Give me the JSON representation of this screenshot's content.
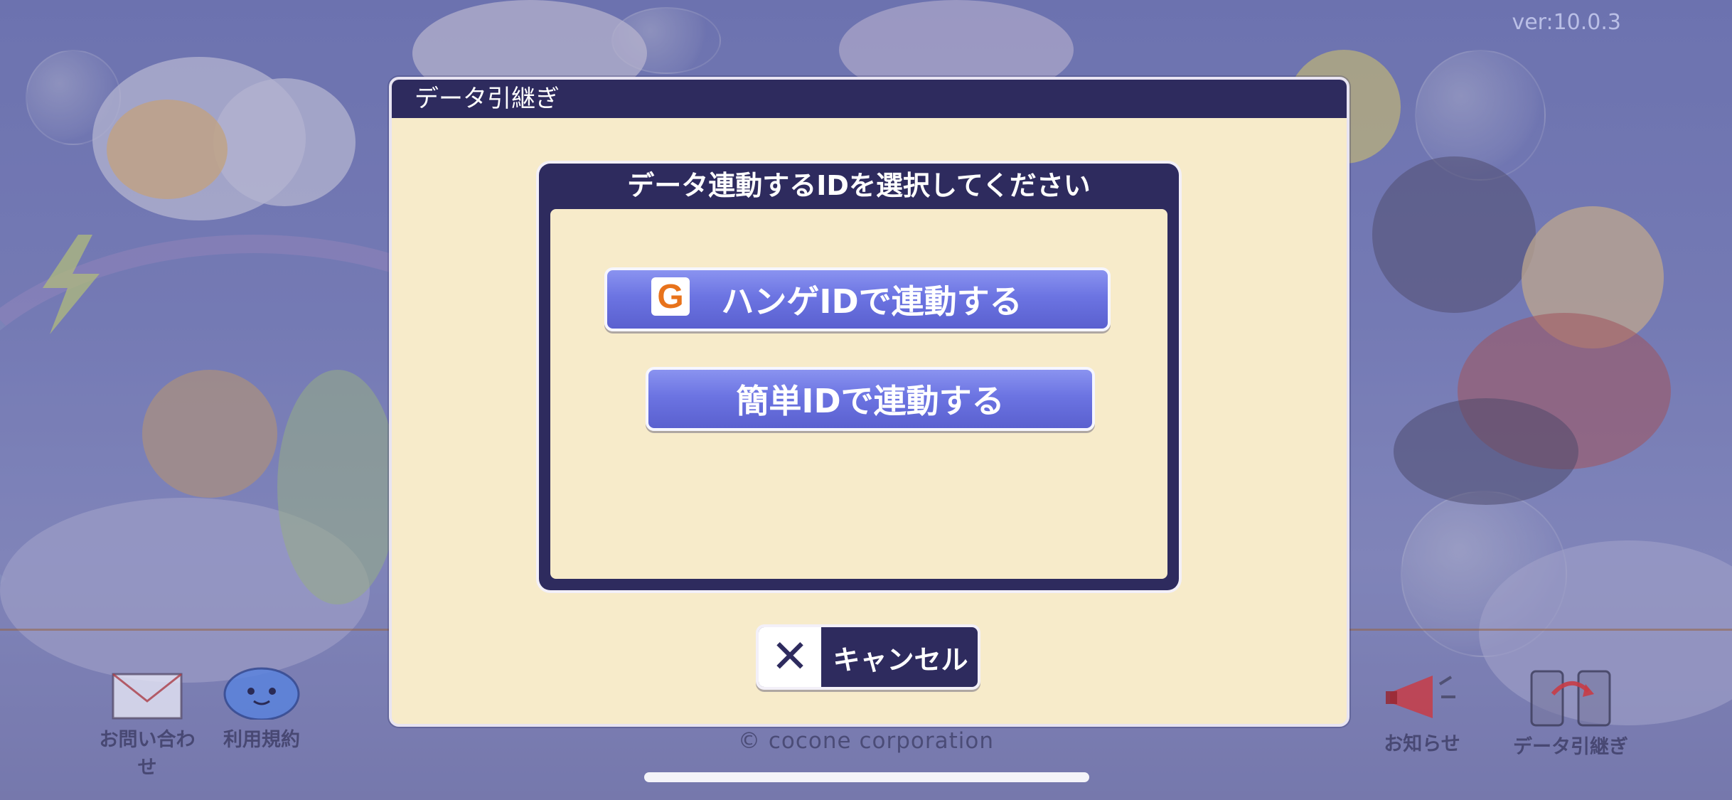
{
  "app": {
    "version": "ver:10.0.3",
    "copyright": "© cocone corporation"
  },
  "corner_buttons": {
    "contact": {
      "label": "お問い合わせ",
      "icon": "envelope-icon"
    },
    "terms": {
      "label": "利用規約",
      "icon": "slime-icon"
    },
    "news": {
      "label": "お知らせ",
      "icon": "megaphone-icon"
    },
    "transfer": {
      "label": "データ引継ぎ",
      "icon": "phones-transfer-icon"
    }
  },
  "dialog": {
    "title": "データ引継ぎ",
    "panel_title": "データ連動するIDを選択してください",
    "hange_button": {
      "label": "ハンゲIDで連動する",
      "icon": "hange-g-icon",
      "icon_letter": "G"
    },
    "simple_button": {
      "label": "簡単IDで連動する"
    },
    "cancel_button": {
      "label": "キャンセル",
      "icon": "close-icon"
    }
  },
  "colors": {
    "dialog_header": "#2e2b5e",
    "dialog_body": "#f7ebca",
    "button_blue": "#6c74e2",
    "hange_orange": "#e8731b"
  }
}
